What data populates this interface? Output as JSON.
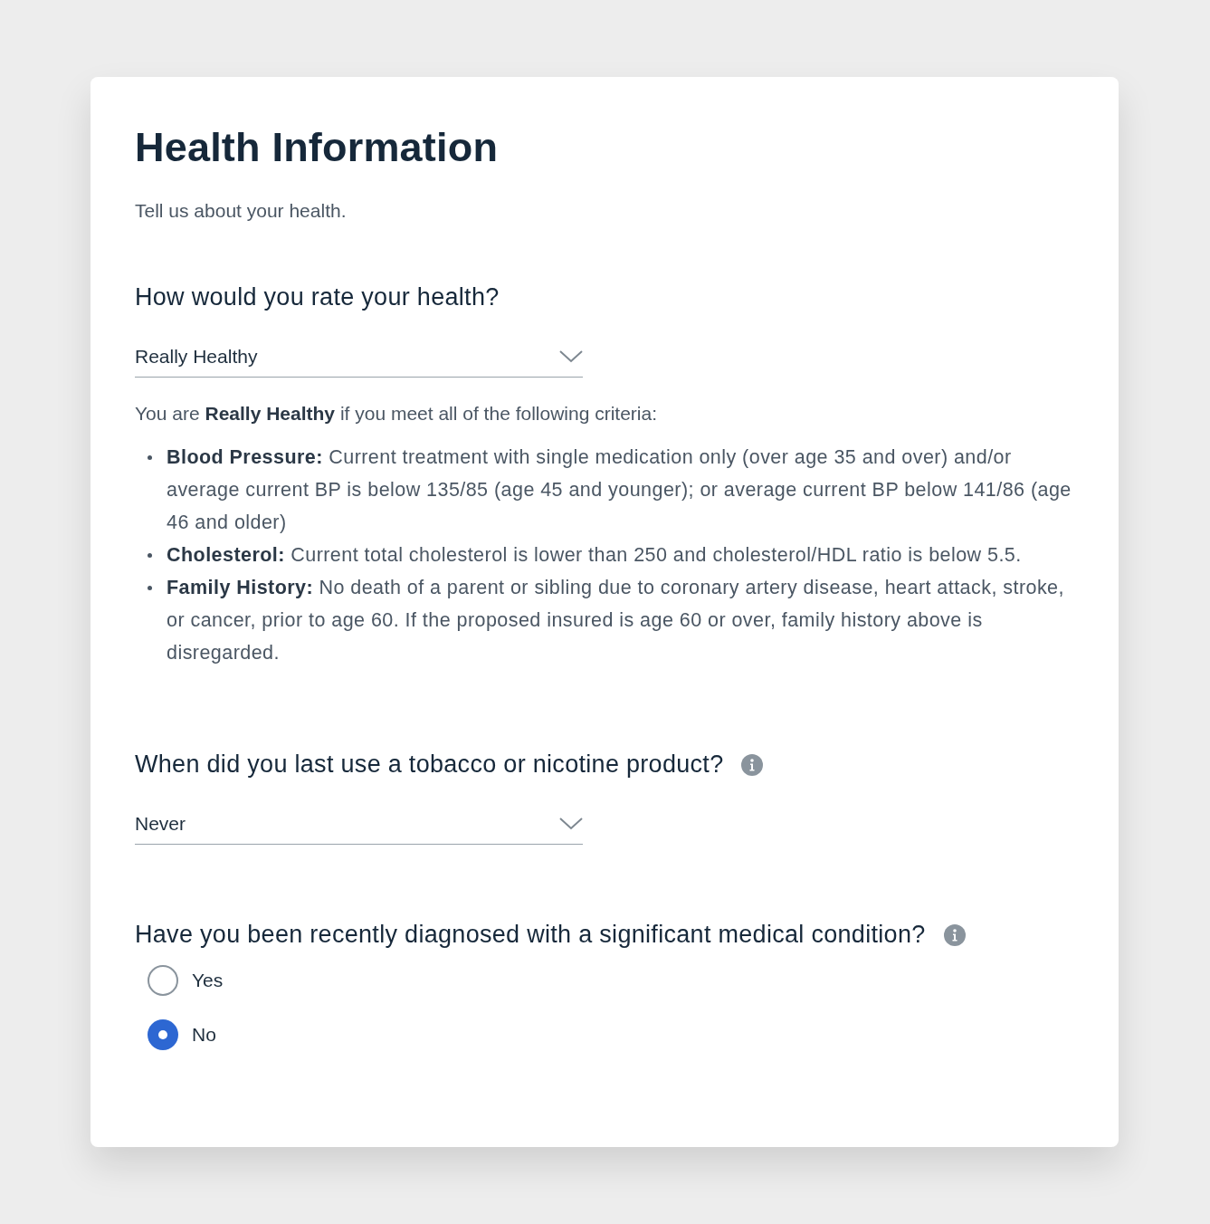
{
  "page": {
    "title": "Health Information",
    "subtitle": "Tell us about your health."
  },
  "questions": [
    {
      "kind": "select",
      "label": "How would you rate your health?",
      "info": false,
      "value": "Really Healthy",
      "note": {
        "intro": "You are **Really Healthy** if you meet all of the following criteria:",
        "criteria": [
          "**Blood Pressure:** Current treatment with single medication only (over age 35 and over) and/or average current BP is below 135/85 (age 45 and younger); or average current BP below 141/86 (age 46 and older)",
          "**Cholesterol:** Current total cholesterol is lower than 250 and cholesterol/HDL ratio is below 5.5.",
          "**Family History:** No death of a parent or sibling due to coronary artery disease, heart attack, stroke, or cancer, prior to age 60. If the proposed insured is age 60 or over, family history above is disregarded."
        ]
      }
    },
    {
      "kind": "select",
      "label": "When did you last use a tobacco or nicotine product?",
      "info": true,
      "value": "Never"
    },
    {
      "kind": "radio",
      "label": "Have you been recently diagnosed with a significant medical condition?",
      "info": true,
      "options": [
        {
          "label": "Yes",
          "selected": false
        },
        {
          "label": "No",
          "selected": true
        }
      ]
    }
  ]
}
